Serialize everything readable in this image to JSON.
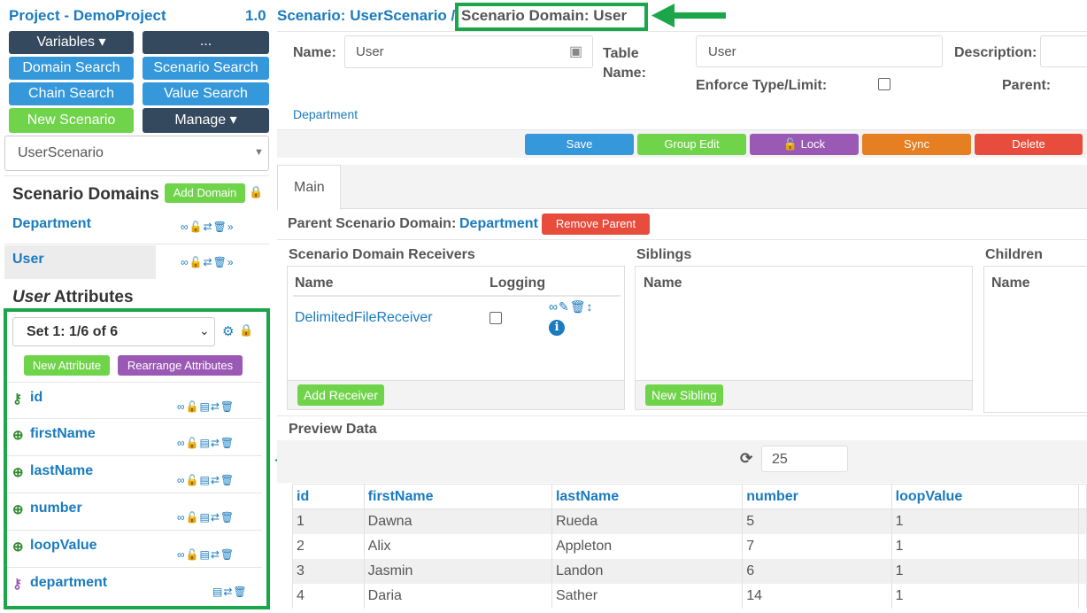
{
  "project": {
    "title": "Project - DemoProject",
    "version": "1.0"
  },
  "breadcrumb": {
    "scenario": "Scenario: UserScenario /",
    "domain": "Scenario Domain: User"
  },
  "left_buttons": {
    "variables": "Variables ▾",
    "more": "...",
    "domain_search": "Domain Search",
    "scenario_search": "Scenario Search",
    "chain_search": "Chain Search",
    "value_search": "Value Search",
    "new_scenario": "New Scenario",
    "manage": "Manage ▾"
  },
  "scenario_select": {
    "value": "UserScenario"
  },
  "scenario_domains": {
    "heading": "Scenario Domains",
    "add_button": "Add Domain",
    "items": [
      {
        "label": "Department"
      },
      {
        "label": "User"
      }
    ]
  },
  "attributes": {
    "heading_italic": "User",
    "heading_rest": " Attributes",
    "set_select": "Set 1: 1/6 of 6",
    "new_button": "New Attribute",
    "rearrange_button": "Rearrange Attributes",
    "items": [
      {
        "name": "id"
      },
      {
        "name": "firstName"
      },
      {
        "name": "lastName"
      },
      {
        "name": "number"
      },
      {
        "name": "loopValue"
      },
      {
        "name": "department"
      }
    ]
  },
  "form": {
    "name_label": "Name:",
    "name_value": "User",
    "table_name_label_1": "Table",
    "table_name_label_2": "Name:",
    "table_name_value": "User",
    "description_label": "Description:",
    "enforce_label": "Enforce Type/Limit:",
    "parent_label": "Parent:",
    "parent_link": "Department"
  },
  "actions": {
    "save": "Save",
    "group_edit": "Group Edit",
    "lock": "🔓 Lock",
    "sync": "Sync",
    "delete": "Delete"
  },
  "tabs": {
    "main": "Main"
  },
  "parent_domain": {
    "label": "Parent Scenario Domain:",
    "value": "Department",
    "remove_button": "Remove Parent"
  },
  "receivers": {
    "heading": "Scenario Domain Receivers",
    "col_name": "Name",
    "col_logging": "Logging",
    "row_name": "DelimitedFileReceiver",
    "add_button": "Add Receiver"
  },
  "siblings": {
    "heading": "Siblings",
    "col_name": "Name",
    "add_button": "New Sibling"
  },
  "children": {
    "heading": "Children",
    "col_name": "Name"
  },
  "preview": {
    "heading": "Preview Data",
    "count": "25",
    "columns": [
      "id",
      "firstName",
      "lastName",
      "number",
      "loopValue"
    ],
    "rows": [
      [
        "1",
        "Dawna",
        "Rueda",
        "5",
        "1"
      ],
      [
        "2",
        "Alix",
        "Appleton",
        "7",
        "1"
      ],
      [
        "3",
        "Jasmin",
        "Landon",
        "6",
        "1"
      ],
      [
        "4",
        "Daria",
        "Sather",
        "14",
        "1"
      ]
    ]
  },
  "colors": {
    "highlight": "#1ba64a",
    "link": "#1a7bbf"
  }
}
